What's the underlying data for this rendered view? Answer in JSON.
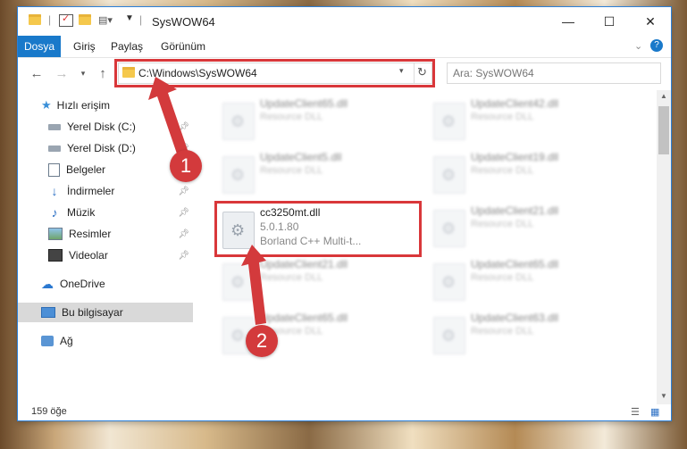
{
  "window": {
    "title": "SysWOW64",
    "controls": {
      "minimize": "—",
      "maximize": "☐",
      "close": "✕"
    }
  },
  "ribbon": {
    "tabs": [
      "Dosya",
      "Giriş",
      "Paylaş",
      "Görünüm"
    ],
    "active_tab": "Dosya"
  },
  "navigation": {
    "path": "C:\\Windows\\SysWOW64",
    "search_placeholder": "Ara: SysWOW64"
  },
  "sidebar": {
    "quick_access": "Hızlı erişim",
    "items": [
      {
        "label": "Yerel Disk (C:)",
        "icon": "drive-icon",
        "pinned": true
      },
      {
        "label": "Yerel Disk (D:)",
        "icon": "drive-icon",
        "pinned": true
      },
      {
        "label": "Belgeler",
        "icon": "documents-icon",
        "pinned": true
      },
      {
        "label": "İndirmeler",
        "icon": "download-icon",
        "pinned": true
      },
      {
        "label": "Müzik",
        "icon": "music-icon",
        "pinned": true
      },
      {
        "label": "Resimler",
        "icon": "pictures-icon",
        "pinned": true
      },
      {
        "label": "Videolar",
        "icon": "videos-icon",
        "pinned": true
      }
    ],
    "onedrive": "OneDrive",
    "this_pc": "Bu bilgisayar",
    "network": "Ağ"
  },
  "files": [
    {
      "name": "UpdateClient65.dll",
      "desc": "Resource DLL"
    },
    {
      "name": "UpdateClient42.dll",
      "desc": "Resource DLL"
    },
    {
      "name": "UpdateClient5.dll",
      "desc": "Resource DLL"
    },
    {
      "name": "UpdateClient19.dll",
      "desc": "Resource DLL"
    },
    {
      "name": "cc3250mt.dll",
      "version": "5.0.1.80",
      "desc": "Borland C++ Multi-t..."
    },
    {
      "name": "UpdateClient21.dll",
      "desc": "Resource DLL"
    },
    {
      "name": "UpdateClient21.dll",
      "desc": "Resource DLL"
    },
    {
      "name": "UpdateClient65.dll",
      "desc": "Resource DLL"
    },
    {
      "name": "UpdateClient65.dll",
      "desc": "Resource DLL"
    },
    {
      "name": "UpdateClient63.dll",
      "desc": "Resource DLL"
    }
  ],
  "status": {
    "item_count": "159 öğe"
  },
  "annotations": {
    "badge1": "1",
    "badge2": "2"
  },
  "colors": {
    "accent": "#1979ca",
    "highlight_red": "#d9373a"
  }
}
